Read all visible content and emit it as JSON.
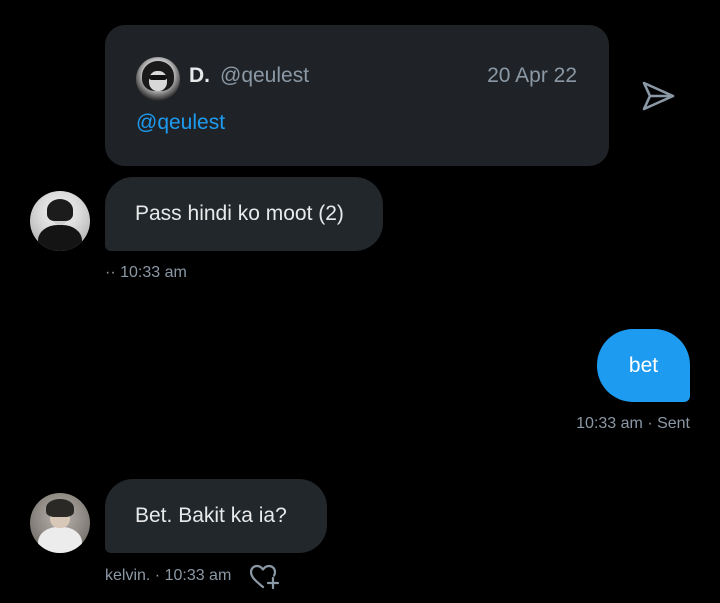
{
  "quoted_tweet": {
    "author_name": "D.",
    "author_handle": "@qeulest",
    "date": "20 Apr 22",
    "body": "@qeulest"
  },
  "icons": {
    "share": "send-icon",
    "react": "heart-plus-icon"
  },
  "messages": [
    {
      "direction": "received",
      "text": "Pass hindi ko moot (2)",
      "meta": "·· 10:33 am"
    },
    {
      "direction": "sent",
      "text": "bet",
      "meta": "10:33 am · Sent"
    },
    {
      "direction": "received",
      "text": "Bet. Bakit ka ia?",
      "meta": "kelvin. · 10:33 am"
    }
  ],
  "colors": {
    "background": "#000000",
    "card": "#1f2327",
    "bubble_in": "#22272b",
    "bubble_out": "#1d9bf0",
    "link": "#1d9bf0",
    "muted": "#8b98a5"
  }
}
